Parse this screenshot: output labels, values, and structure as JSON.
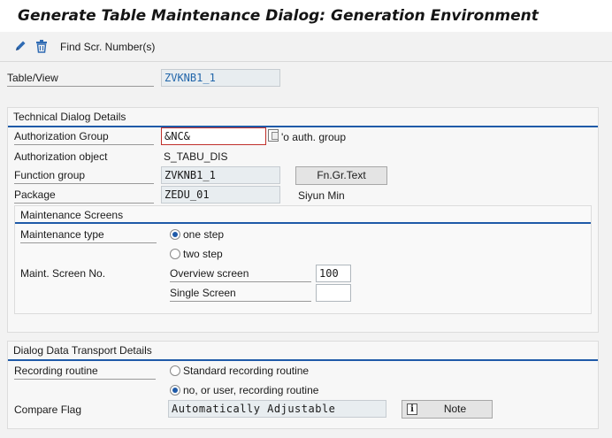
{
  "window": {
    "title": "Generate Table Maintenance Dialog: Generation Environment"
  },
  "toolbar": {
    "find_label": "Find Scr. Number(s)"
  },
  "table_view": {
    "label": "Table/View",
    "value": "ZVKNB1_1"
  },
  "technical": {
    "title": "Technical Dialog Details",
    "auth_group": {
      "label": "Authorization Group",
      "value": "&NC&",
      "suffix": "'o auth. group"
    },
    "auth_object": {
      "label": "Authorization object",
      "value": "S_TABU_DIS"
    },
    "function_group": {
      "label": "Function group",
      "value": "ZVKNB1_1",
      "button": "Fn.Gr.Text"
    },
    "package": {
      "label": "Package",
      "value": "ZEDU_01",
      "owner": "Siyun Min"
    }
  },
  "maintenance": {
    "title": "Maintenance Screens",
    "type_label": "Maintenance type",
    "one_step": "one step",
    "two_step": "two step",
    "selected": "one step",
    "screen_no_label": "Maint. Screen No.",
    "overview_label": "Overview screen",
    "overview_value": "100",
    "single_label": "Single Screen",
    "single_value": ""
  },
  "transport": {
    "title": "Dialog Data Transport Details",
    "recording_label": "Recording routine",
    "standard_option": "Standard recording routine",
    "user_option": "no, or user, recording routine",
    "selected": "no, or user, recording routine",
    "compare_label": "Compare Flag",
    "compare_value": "Automatically Adjustable",
    "note_button": "Note"
  }
}
